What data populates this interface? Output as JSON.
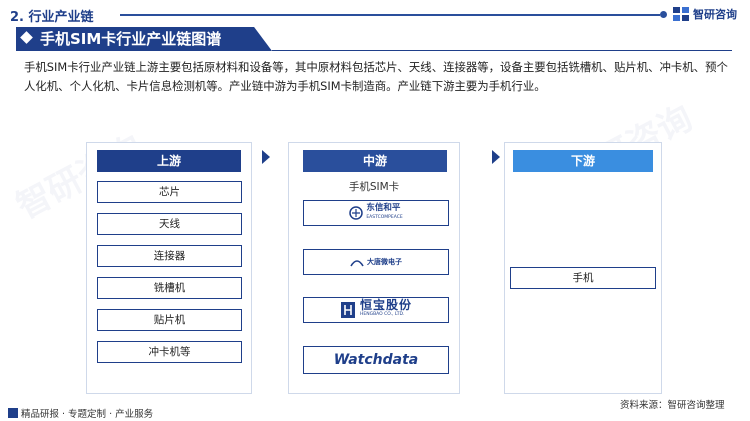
{
  "section": {
    "label": "2. 行业产业链"
  },
  "brand": {
    "name": "智研咨询",
    "accent": "#1f3f8a"
  },
  "title": "手机SIM卡行业产业链图谱",
  "intro": "手机SIM卡行业产业链上游主要包括原材料和设备等，其中原材料包括芯片、天线、连接器等，设备主要包括铣槽机、贴片机、冲卡机、预个人化机、个人化机、卡片信息检测机等。产业链中游为手机SIM卡制造商。产业链下游主要为手机行业。",
  "upstream": {
    "header": "上游",
    "items": [
      "芯片",
      "天线",
      "连接器",
      "铣槽机",
      "贴片机",
      "冲卡机等"
    ]
  },
  "midstream": {
    "header": "中游",
    "subtitle": "手机SIM卡",
    "companies": [
      {
        "name": "东信和平",
        "sub": "EASTCOMPEACE",
        "icon": "eastcompeace-logo-icon"
      },
      {
        "name": "大唐微电子",
        "sub": "",
        "icon": "datang-logo-icon"
      },
      {
        "name": "恒宝股份",
        "sub": "HENGBAO CO., LTD.",
        "icon": "hengbao-logo-icon"
      },
      {
        "name": "Watchdata",
        "sub": "",
        "icon": "watchdata-logo-icon"
      }
    ]
  },
  "downstream": {
    "header": "下游",
    "items": [
      "手机"
    ]
  },
  "footer": {
    "left": "精品研报 · 专题定制 · 产业服务",
    "right": "资料来源：智研咨询整理"
  },
  "watermark": "智研咨询"
}
